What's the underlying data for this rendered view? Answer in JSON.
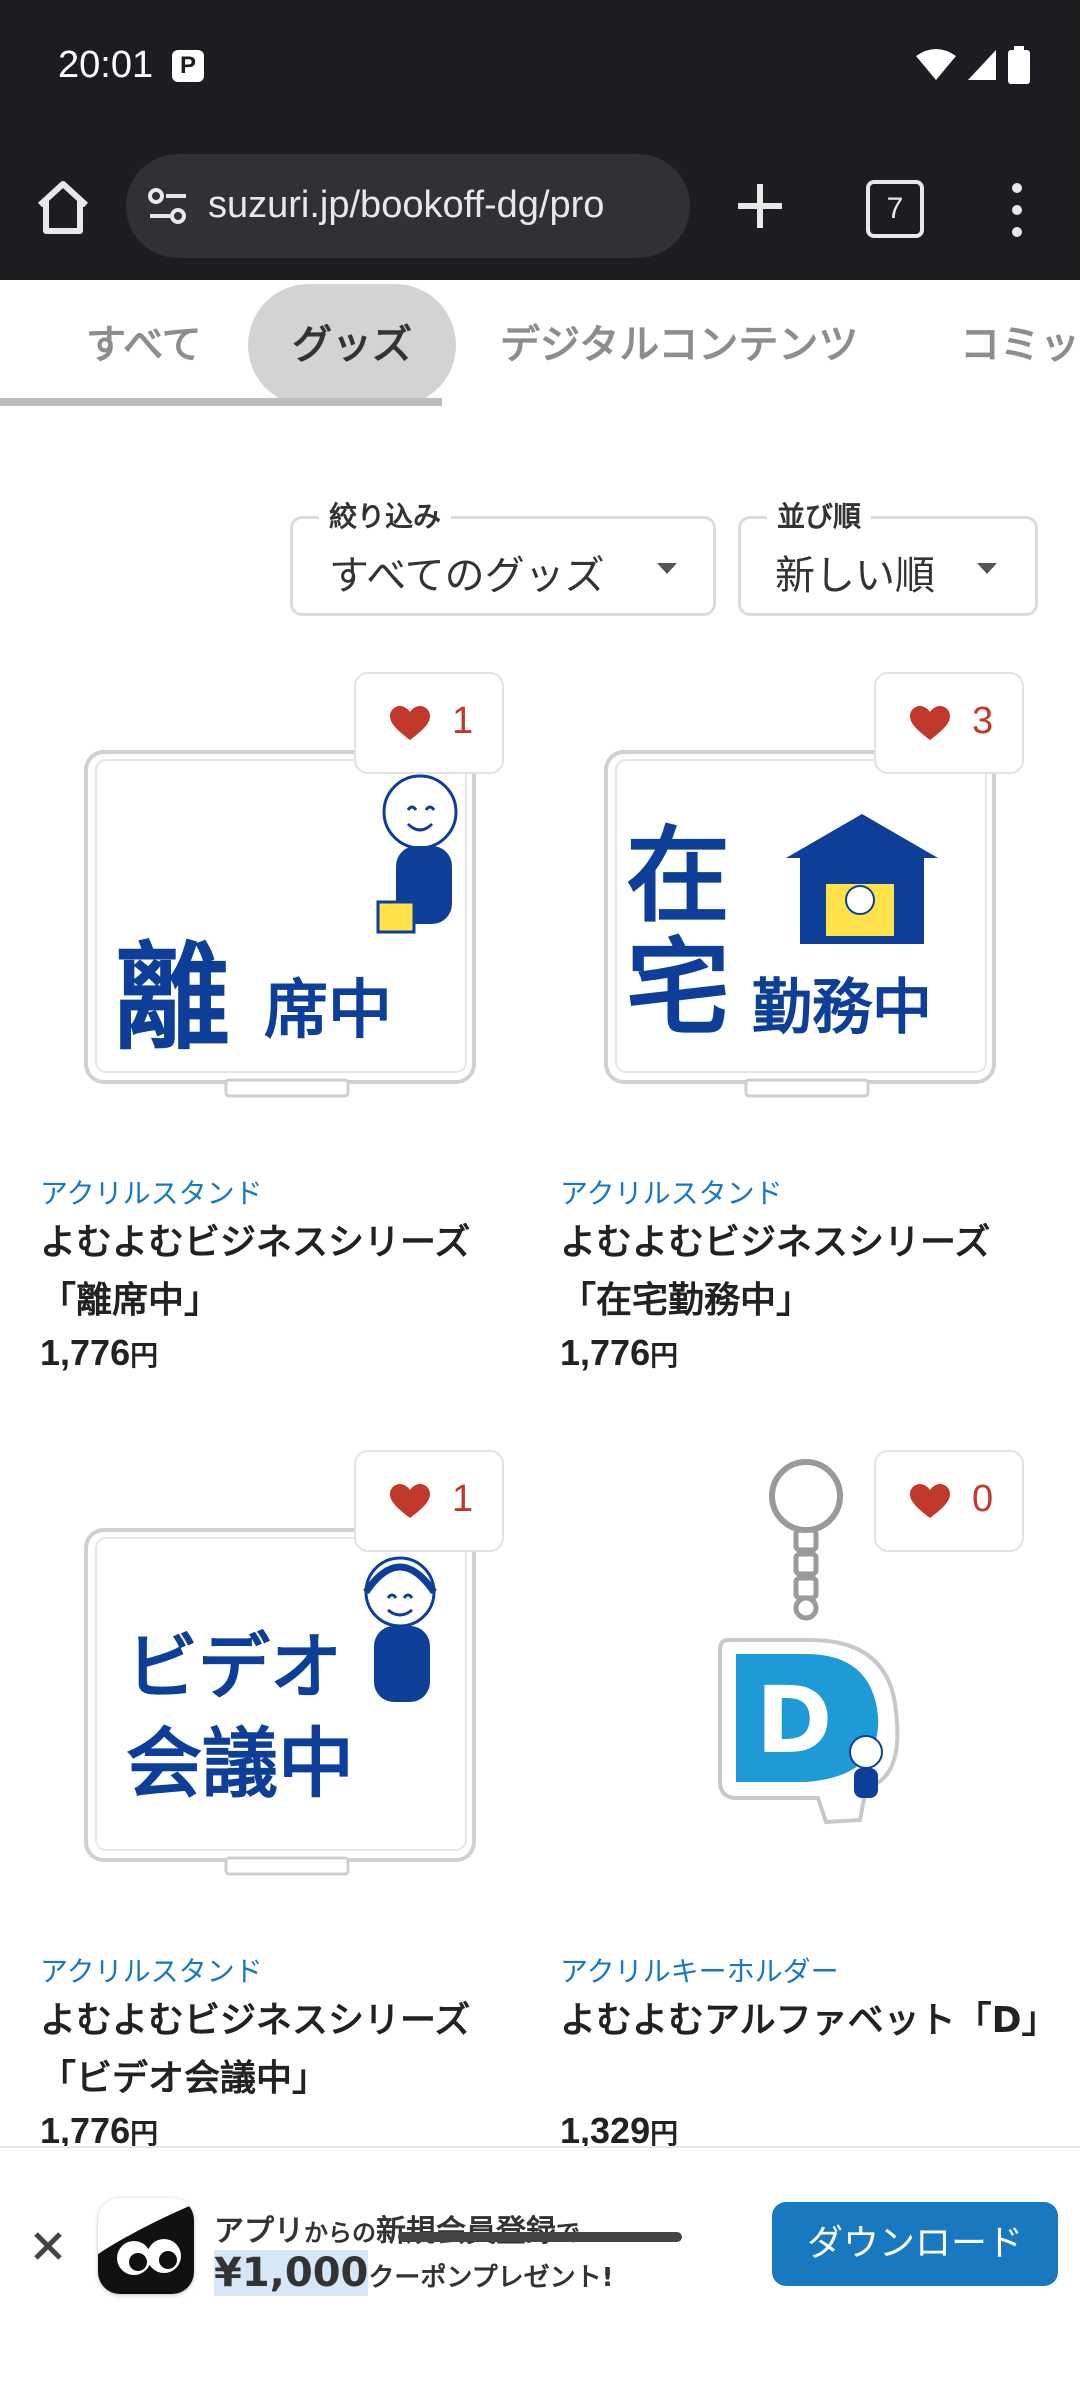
{
  "status_bar": {
    "time": "20:01",
    "badge": "P"
  },
  "browser": {
    "url": "suzuri.jp/bookoff-dg/pro",
    "tab_count": "7"
  },
  "category_tabs": [
    {
      "label": "すべて"
    },
    {
      "label": "グッズ",
      "selected": true
    },
    {
      "label": "デジタルコンテンツ"
    },
    {
      "label": "コミッ"
    }
  ],
  "filters": {
    "narrow": {
      "label": "絞り込み",
      "value": "すべてのグッズ"
    },
    "sort": {
      "label": "並び順",
      "value": "新しい順"
    }
  },
  "products": [
    {
      "category": "アクリルスタンド",
      "title": "よむよむビジネスシリーズ「離席中」",
      "price": "1,776",
      "currency": "円",
      "likes": "1",
      "art_text": [
        "離",
        "席中"
      ]
    },
    {
      "category": "アクリルスタンド",
      "title": "よむよむビジネスシリーズ「在宅勤務中」",
      "price": "1,776",
      "currency": "円",
      "likes": "3",
      "art_text": [
        "在",
        "宅",
        "勤務中"
      ]
    },
    {
      "category": "アクリルスタンド",
      "title": "よむよむビジネスシリーズ「ビデオ会議中」",
      "price": "1,776",
      "currency": "円",
      "likes": "1",
      "art_text": [
        "ビデオ",
        "会議中"
      ]
    },
    {
      "category": "アクリルキーホルダー",
      "title": "よむよむアルファベット「D」",
      "price": "1,329",
      "currency": "円",
      "likes": "0",
      "art_text": [
        "D"
      ]
    }
  ],
  "banner": {
    "line1_a": "アプリ",
    "line1_b": "からの",
    "line1_c": "新規会員登録",
    "line1_d": "で",
    "amount": "¥1,000",
    "line2": "クーポンプレゼント!",
    "button": "ダウンロード"
  },
  "colors": {
    "accent": "#1879c0",
    "heart": "#c0392b",
    "art_blue": "#0d3f99"
  }
}
